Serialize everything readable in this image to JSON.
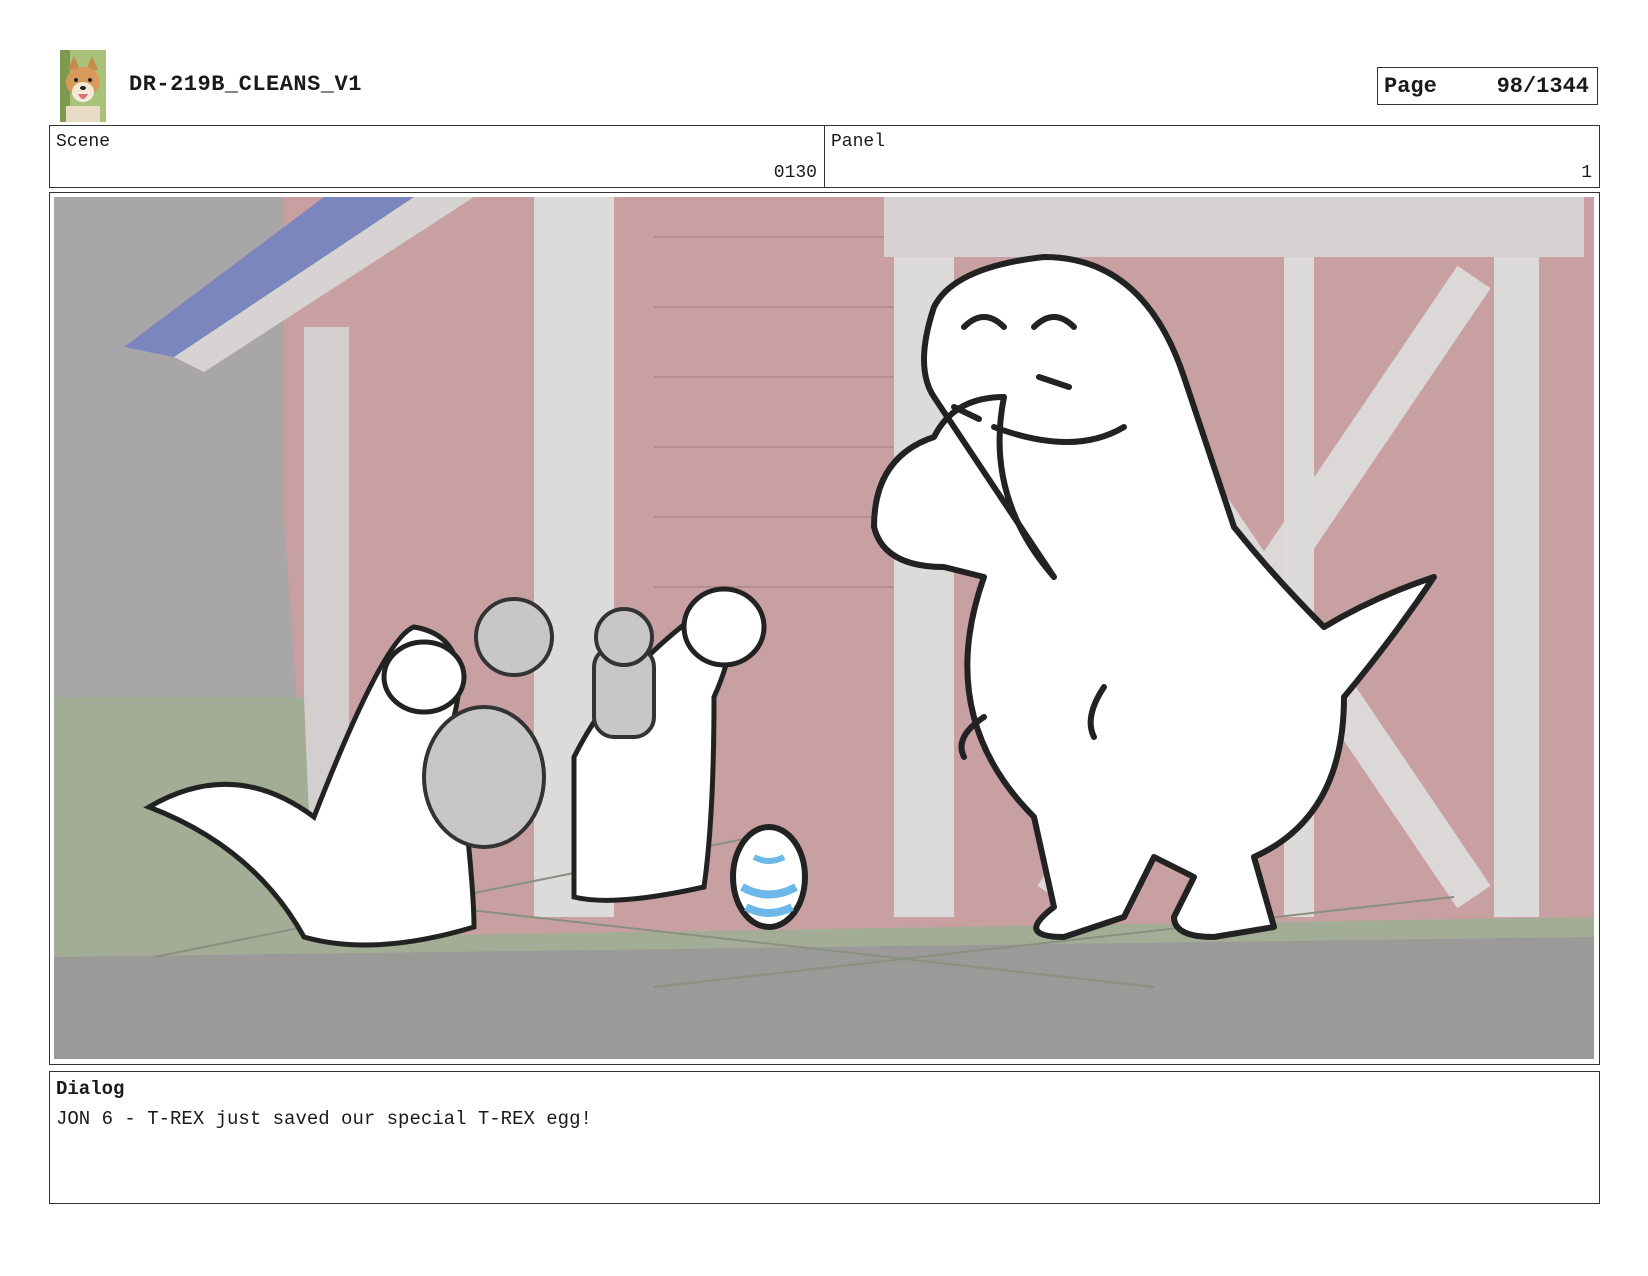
{
  "header": {
    "title": "DR-219B_CLEANS_V1",
    "thumbnail_icon": "dog-avatar-icon",
    "page_label": "Page",
    "page_value": "98/1344"
  },
  "info": {
    "scene_label": "Scene",
    "scene_value": "0130",
    "panel_label": "Panel",
    "panel_value": "1"
  },
  "panel_image": {
    "icon": "storyboard-sketch-icon",
    "colors": {
      "barn_red": "#c9a0a2",
      "ground": "#a3ad95",
      "sky": "#9a9a9a",
      "egg_stripes": "#6cb8e8",
      "roof": "#7a86bd"
    }
  },
  "dialog": {
    "label": "Dialog",
    "text": "JON 6 - T-REX just saved our special T-REX egg!"
  }
}
